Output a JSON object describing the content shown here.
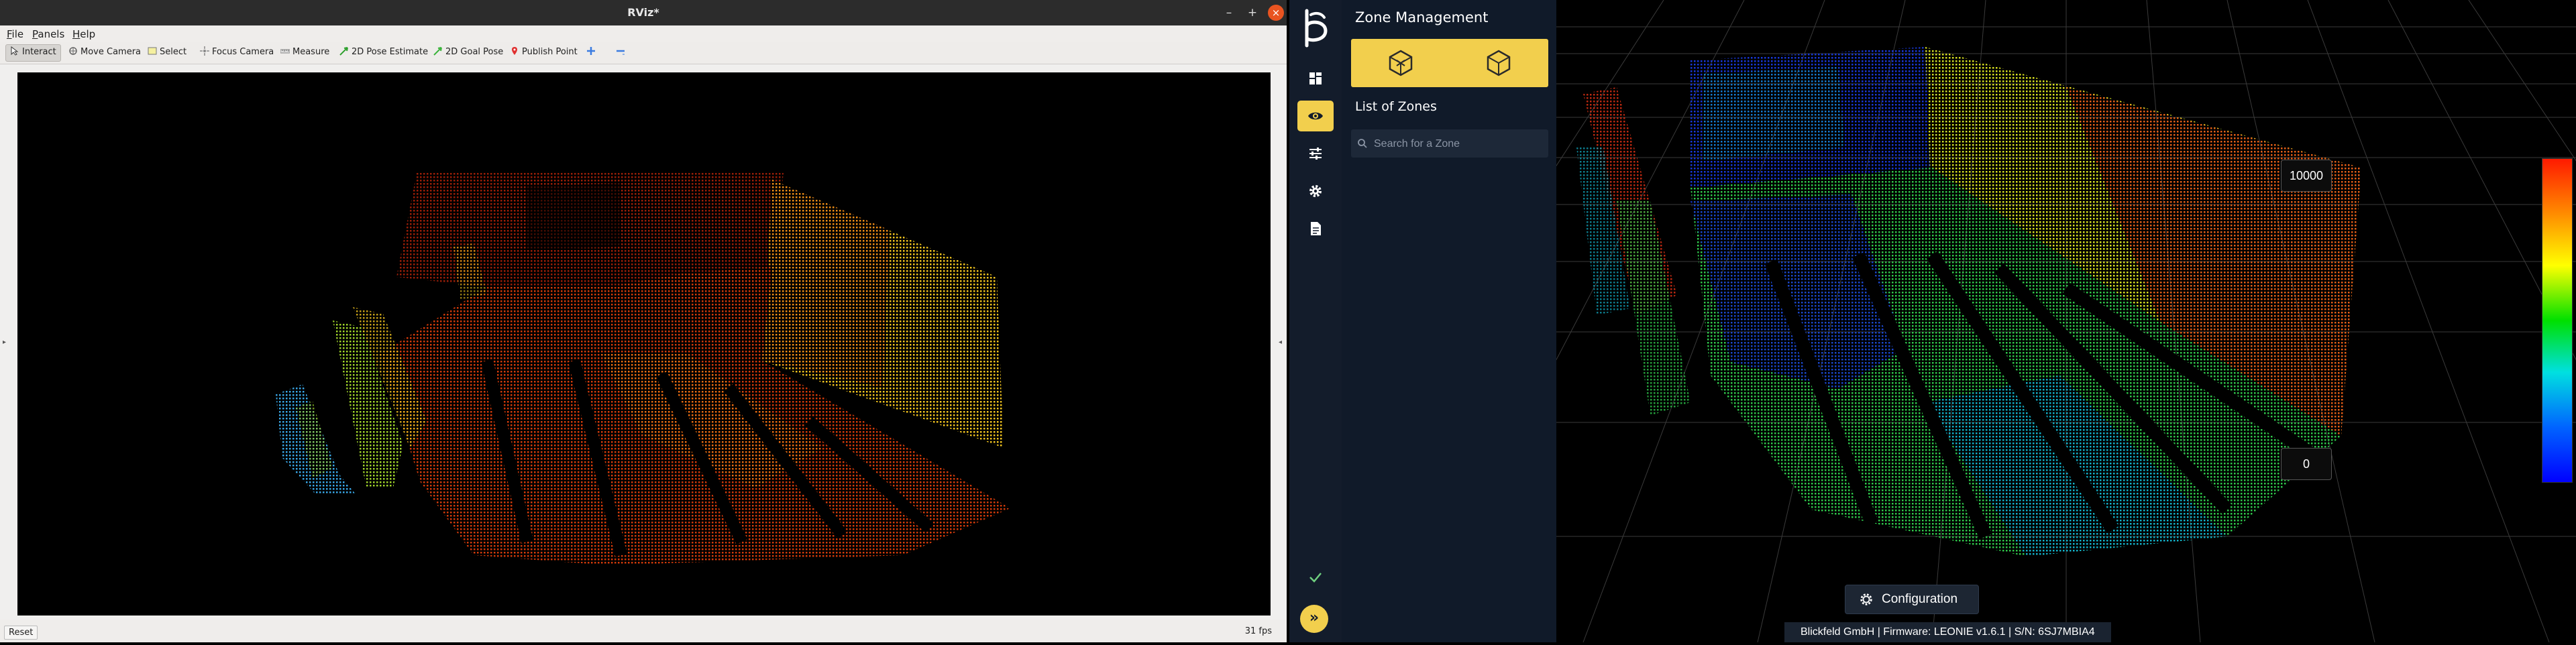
{
  "rviz": {
    "title": "RViz*",
    "window_buttons": {
      "minimize": "–",
      "maximize": "+",
      "close": "×"
    },
    "menu": {
      "file": {
        "mnemonic": "F",
        "rest": "ile"
      },
      "panels": {
        "mnemonic": "P",
        "rest": "anels"
      },
      "help": {
        "mnemonic": "H",
        "rest": "elp"
      }
    },
    "toolbar": {
      "interact": "Interact",
      "move_camera": "Move Camera",
      "select": "Select",
      "focus_camera": "Focus Camera",
      "measure": "Measure",
      "pose_estimate": "2D Pose Estimate",
      "goal_pose": "2D Goal Pose",
      "publish_point": "Publish Point"
    },
    "status": {
      "reset": "Reset",
      "fps": "31 fps"
    }
  },
  "app": {
    "zone_panel": {
      "title": "Zone Management",
      "list_title": "List of Zones",
      "search_placeholder": "Search for a Zone"
    },
    "scene": {
      "scale_max": "10000",
      "scale_min": "0",
      "config_label": "Configuration",
      "footer": "Blickfeld GmbH  |  Firmware: LEONIE v1.6.1  |  S/N: 6SJ7MBIA4"
    },
    "colors": {
      "accent": "#f2cf4d",
      "sidebar_bg": "#131c2b",
      "panel_bg": "#101a29",
      "close_button": "#e95420"
    }
  }
}
